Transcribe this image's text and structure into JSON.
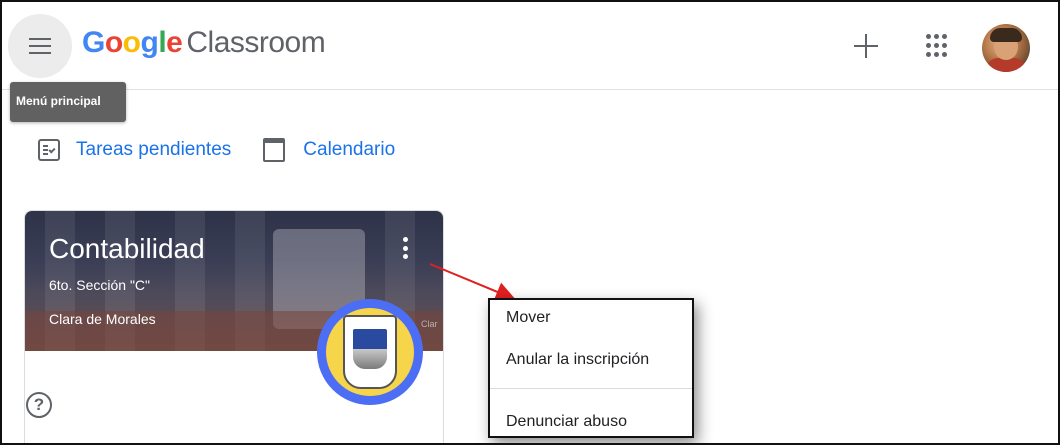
{
  "app": {
    "logo_google": "Google",
    "logo_product": "Classroom",
    "logo_colors": [
      "#4285F4",
      "#EA4335",
      "#FBBC05",
      "#4285F4",
      "#34A853",
      "#EA4335"
    ]
  },
  "header": {
    "menu_tooltip": "Menú principal",
    "menu_icon": "hamburger-icon",
    "create_icon": "plus-icon",
    "apps_icon": "apps-grid-icon",
    "avatar_icon": "user-avatar"
  },
  "nav": {
    "todo_label": "Tareas pendientes",
    "todo_icon": "assignment-check-icon",
    "calendar_label": "Calendario",
    "calendar_icon": "calendar-icon",
    "accent": "#1a73e8"
  },
  "course": {
    "title": "Contabilidad",
    "section": "6to. Sección \"C\"",
    "teacher": "Clara de Morales",
    "banner_fade_text": "Clar",
    "more_icon": "more-vert-icon",
    "help_icon": "help-circle-icon"
  },
  "context_menu": {
    "items": [
      "Mover",
      "Anular la inscripción",
      "Denunciar abuso"
    ]
  },
  "annotation": {
    "arrow_color": "#e02020"
  }
}
